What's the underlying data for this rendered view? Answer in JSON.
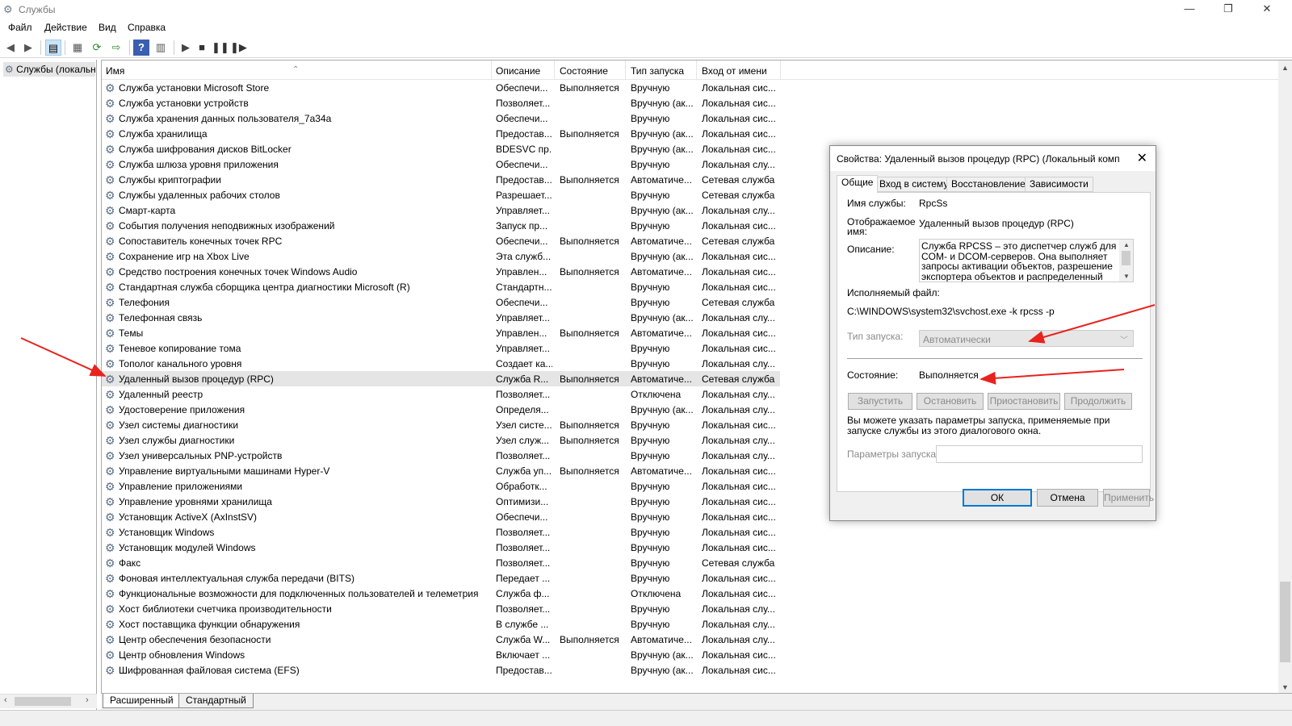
{
  "window": {
    "title": "Службы",
    "minimize_glyph": "—",
    "restore_glyph": "❐",
    "close_glyph": "✕"
  },
  "menu": [
    "Файл",
    "Действие",
    "Вид",
    "Справка"
  ],
  "toolbar_icons": [
    "back-icon",
    "forward-icon",
    "show-hide-console-tree-icon",
    "properties-icon",
    "refresh-icon",
    "export-list-icon",
    "help-icon",
    "show-hide-action-pane-icon",
    "play-icon",
    "stop-icon",
    "pause-icon",
    "restart-icon"
  ],
  "tree": {
    "root_label": "Службы (локальные)"
  },
  "columns": [
    "Имя",
    "Описание",
    "Состояние",
    "Тип запуска",
    "Вход от имени"
  ],
  "rows": [
    [
      "Служба установки Microsoft Store",
      "Обеспечи...",
      "Выполняется",
      "Вручную",
      "Локальная сис..."
    ],
    [
      "Служба установки устройств",
      "Позволяет...",
      "",
      "Вручную (ак...",
      "Локальная сис..."
    ],
    [
      "Служба хранения данных пользователя_7a34a",
      "Обеспечи...",
      "",
      "Вручную",
      "Локальная сис..."
    ],
    [
      "Служба хранилища",
      "Предостав...",
      "Выполняется",
      "Вручную (ак...",
      "Локальная сис..."
    ],
    [
      "Служба шифрования дисков BitLocker",
      "BDESVC пр...",
      "",
      "Вручную (ак...",
      "Локальная сис..."
    ],
    [
      "Служба шлюза уровня приложения",
      "Обеспечи...",
      "",
      "Вручную",
      "Локальная слу..."
    ],
    [
      "Службы криптографии",
      "Предостав...",
      "Выполняется",
      "Автоматиче...",
      "Сетевая служба"
    ],
    [
      "Службы удаленных рабочих столов",
      "Разрешает...",
      "",
      "Вручную",
      "Сетевая служба"
    ],
    [
      "Смарт-карта",
      "Управляет...",
      "",
      "Вручную (ак...",
      "Локальная слу..."
    ],
    [
      "События получения неподвижных изображений",
      "Запуск пр...",
      "",
      "Вручную",
      "Локальная сис..."
    ],
    [
      "Сопоставитель конечных точек RPC",
      "Обеспечи...",
      "Выполняется",
      "Автоматиче...",
      "Сетевая служба"
    ],
    [
      "Сохранение игр на Xbox Live",
      "Эта служб...",
      "",
      "Вручную (ак...",
      "Локальная сис..."
    ],
    [
      "Средство построения конечных точек Windows Audio",
      "Управлен...",
      "Выполняется",
      "Автоматиче...",
      "Локальная сис..."
    ],
    [
      "Стандартная служба сборщика центра диагностики Microsoft (R)",
      "Стандартн...",
      "",
      "Вручную",
      "Локальная сис..."
    ],
    [
      "Телефония",
      "Обеспечи...",
      "",
      "Вручную",
      "Сетевая служба"
    ],
    [
      "Телефонная связь",
      "Управляет...",
      "",
      "Вручную (ак...",
      "Локальная слу..."
    ],
    [
      "Темы",
      "Управлен...",
      "Выполняется",
      "Автоматиче...",
      "Локальная сис..."
    ],
    [
      "Теневое копирование тома",
      "Управляет...",
      "",
      "Вручную",
      "Локальная сис..."
    ],
    [
      "Тополог канального уровня",
      "Создает ка...",
      "",
      "Вручную",
      "Локальная слу..."
    ],
    [
      "Удаленный вызов процедур (RPC)",
      "Служба R...",
      "Выполняется",
      "Автоматиче...",
      "Сетевая служба"
    ],
    [
      "Удаленный реестр",
      "Позволяет...",
      "",
      "Отключена",
      "Локальная слу..."
    ],
    [
      "Удостоверение приложения",
      "Определя...",
      "",
      "Вручную (ак...",
      "Локальная слу..."
    ],
    [
      "Узел системы диагностики",
      "Узел систе...",
      "Выполняется",
      "Вручную",
      "Локальная сис..."
    ],
    [
      "Узел службы диагностики",
      "Узел служ...",
      "Выполняется",
      "Вручную",
      "Локальная слу..."
    ],
    [
      "Узел универсальных PNP-устройств",
      "Позволяет...",
      "",
      "Вручную",
      "Локальная слу..."
    ],
    [
      "Управление виртуальными машинами Hyper-V",
      "Служба уп...",
      "Выполняется",
      "Автоматиче...",
      "Локальная сис..."
    ],
    [
      "Управление приложениями",
      "Обработк...",
      "",
      "Вручную",
      "Локальная сис..."
    ],
    [
      "Управление уровнями хранилища",
      "Оптимизи...",
      "",
      "Вручную",
      "Локальная сис..."
    ],
    [
      "Установщик ActiveX (AxInstSV)",
      "Обеспечи...",
      "",
      "Вручную",
      "Локальная сис..."
    ],
    [
      "Установщик Windows",
      "Позволяет...",
      "",
      "Вручную",
      "Локальная сис..."
    ],
    [
      "Установщик модулей Windows",
      "Позволяет...",
      "",
      "Вручную",
      "Локальная сис..."
    ],
    [
      "Факс",
      "Позволяет...",
      "",
      "Вручную",
      "Сетевая служба"
    ],
    [
      "Фоновая интеллектуальная служба передачи (BITS)",
      "Передает ...",
      "",
      "Вручную",
      "Локальная сис..."
    ],
    [
      "Функциональные возможности для подключенных пользователей и телеметрия",
      "Служба ф...",
      "",
      "Отключена",
      "Локальная сис..."
    ],
    [
      "Хост библиотеки счетчика производительности",
      "Позволяет...",
      "",
      "Вручную",
      "Локальная слу..."
    ],
    [
      "Хост поставщика функции обнаружения",
      "В службе ...",
      "",
      "Вручную",
      "Локальная слу..."
    ],
    [
      "Центр обеспечения безопасности",
      "Служба W...",
      "Выполняется",
      "Автоматиче...",
      "Локальная слу..."
    ],
    [
      "Центр обновления Windows",
      "Включает ...",
      "",
      "Вручную (ак...",
      "Локальная сис..."
    ],
    [
      "Шифрованная файловая система (EFS)",
      "Предостав...",
      "",
      "Вручную (ак...",
      "Локальная сис..."
    ]
  ],
  "bottom_tabs": [
    "Расширенный",
    "Стандартный"
  ],
  "dialog": {
    "title": "Свойства: Удаленный вызов процедур (RPC) (Локальный компь...",
    "tabs": [
      "Общие",
      "Вход в систему",
      "Восстановление",
      "Зависимости"
    ],
    "service_name_label": "Имя службы:",
    "service_name": "RpcSs",
    "display_name_label": "Отображаемое имя:",
    "display_name": "Удаленный вызов процедур (RPC)",
    "description_label": "Описание:",
    "description": "Служба RPCSS – это диспетчер служб для COM- и DCOM-серверов. Она выполняет запросы активации объектов, разрешение экспортера объектов и распределенный сбор мусора для",
    "exe_label": "Исполняемый файл:",
    "exe_path": "C:\\WINDOWS\\system32\\svchost.exe -k rpcss -p",
    "startup_type_label": "Тип запуска:",
    "startup_type_value": "Автоматически",
    "status_label": "Состояние:",
    "status_value": "Выполняется",
    "buttons": [
      "Запустить",
      "Остановить",
      "Приостановить",
      "Продолжить"
    ],
    "hint": "Вы можете указать параметры запуска, применяемые при запуске службы из этого диалогового окна.",
    "params_label": "Параметры запуска:",
    "params_value": "",
    "ok": "ОК",
    "cancel": "Отмена",
    "apply": "Применить"
  },
  "colors": {
    "annotation_arrow": "#e8231e",
    "default_button_border": "#0078d7"
  }
}
